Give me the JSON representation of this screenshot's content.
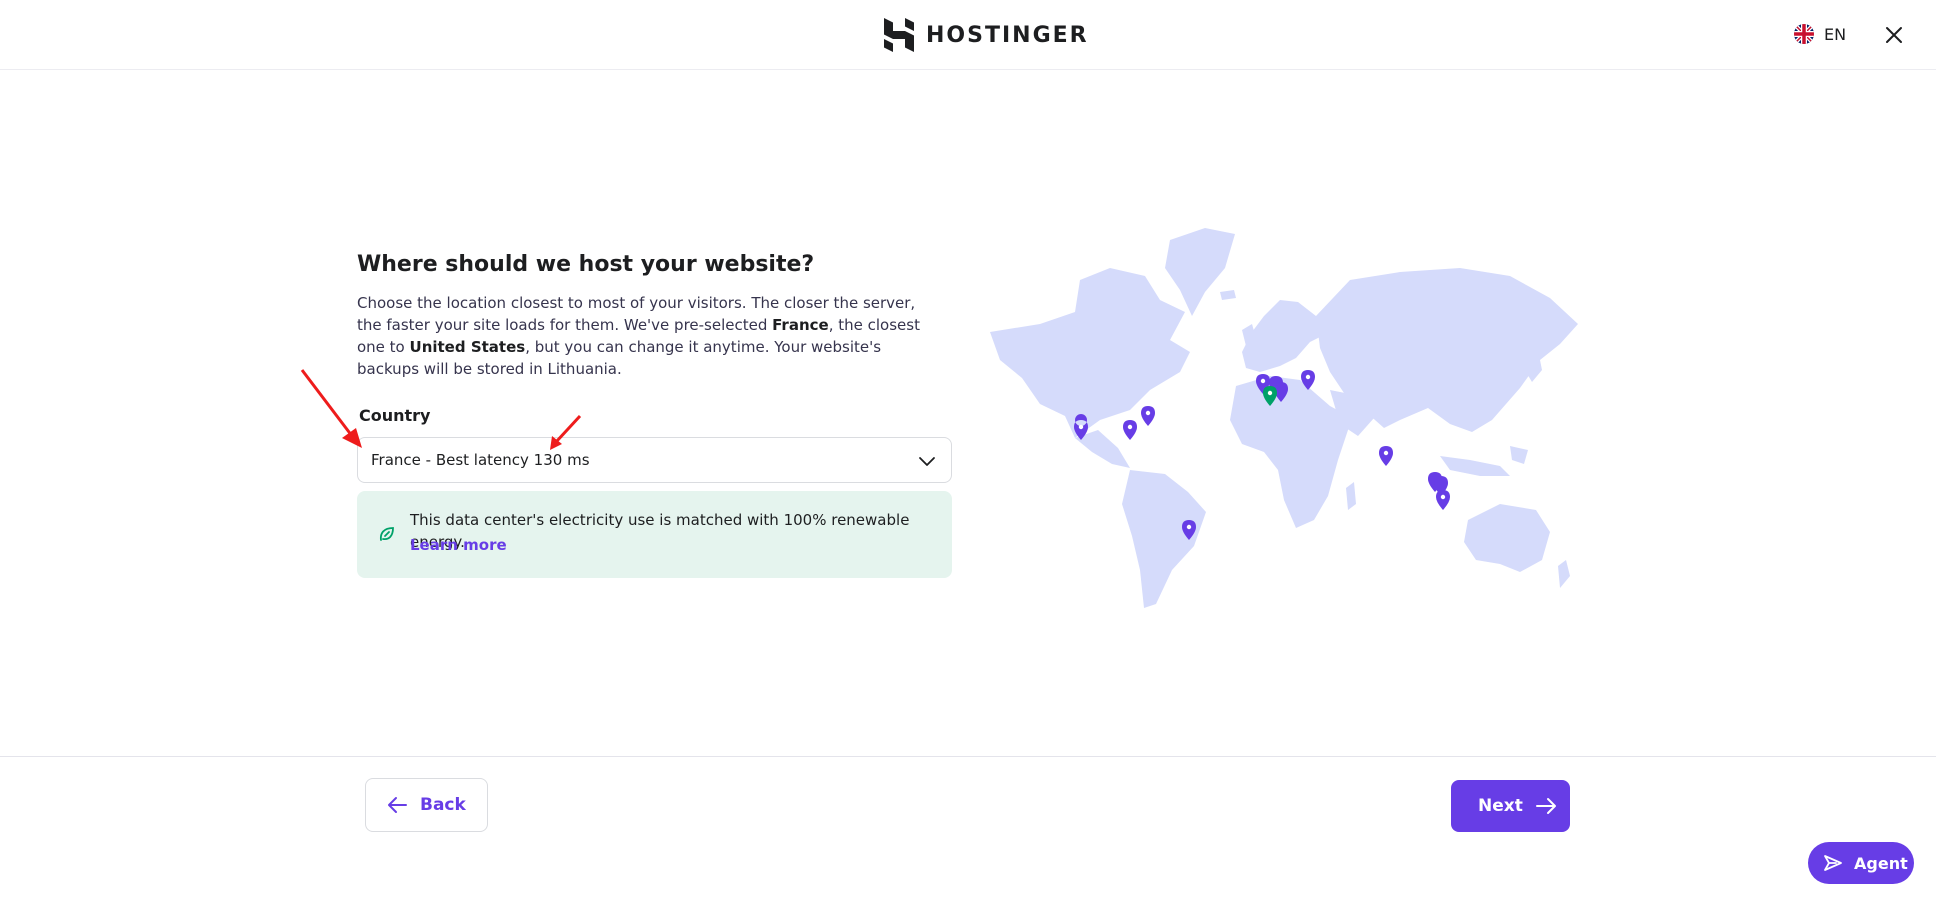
{
  "header": {
    "brand": "HOSTINGER",
    "language": "EN",
    "icons": {
      "flag": "uk-flag-icon",
      "close": "close-icon"
    }
  },
  "main": {
    "title": "Where should we host your website?",
    "description": {
      "p1": "Choose the location closest to most of your visitors. The closer the server, the faster your site loads for them. We've pre-selected ",
      "bold1": "France",
      "p2": ", the closest one to ",
      "bold2": "United States",
      "p3": ", but you can change it anytime. Your website's backups will be stored in Lithuania."
    },
    "country_label": "Country",
    "country_select": {
      "value": "France - Best latency 130 ms"
    },
    "info": {
      "text": "This data center's electricity use is matched with 100% renewable energy.",
      "link": "Learn more",
      "icon": "leaf-icon"
    }
  },
  "footer": {
    "back_label": "Back",
    "next_label": "Next",
    "agent_label": "Agent"
  },
  "colors": {
    "accent": "#673de6",
    "info_bg": "#e5f4ee",
    "map_land": "#d5dbfb",
    "selected_pin": "#00a168"
  }
}
